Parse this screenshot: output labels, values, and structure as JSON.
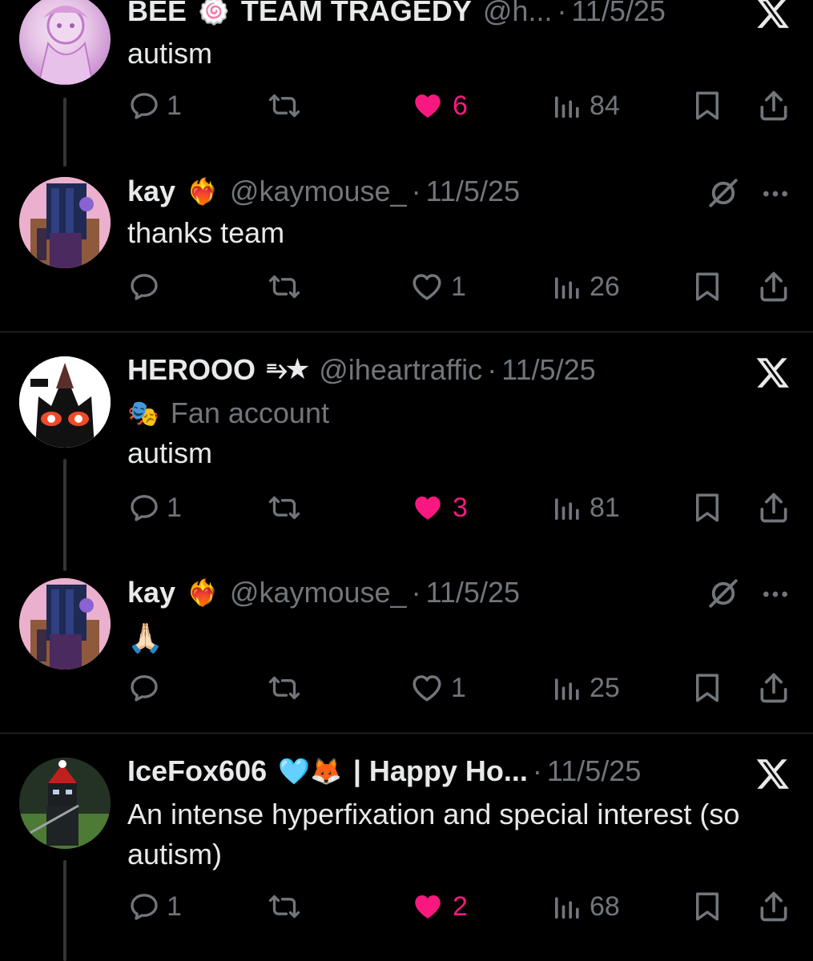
{
  "posts": [
    {
      "name": "BEE",
      "name_badge": "🍥",
      "name_suffix": "TEAM TRAGEDY",
      "handle": "@h...",
      "date": "11/5/25",
      "text": "autism",
      "replies": "1",
      "likes": "6",
      "liked": true,
      "views": "84",
      "corner_icon": "x-logo-icon"
    },
    {
      "name": "kay",
      "name_badge": "❤️‍🔥",
      "handle": "@kaymouse_",
      "date": "11/5/25",
      "text": "thanks team",
      "replies": "",
      "likes": "1",
      "liked": false,
      "views": "26",
      "corner_icon": "grok-icon",
      "more_icon": "more-icon"
    },
    {
      "name": "HEROOO",
      "name_badge": "⥱★",
      "handle": "@iheartraffic",
      "date": "11/5/25",
      "label_icon": "🎭",
      "label": "Fan account",
      "text": "autism",
      "replies": "1",
      "likes": "3",
      "liked": true,
      "views": "81",
      "corner_icon": "x-logo-icon"
    },
    {
      "name": "kay",
      "name_badge": "❤️‍🔥",
      "handle": "@kaymouse_",
      "date": "11/5/25",
      "text": "🙏🏻",
      "replies": "",
      "likes": "1",
      "liked": false,
      "views": "25",
      "corner_icon": "grok-icon",
      "more_icon": "more-icon"
    },
    {
      "name": "IceFox606",
      "name_badge": "🩵🦊",
      "name_suffix": "| Happy Ho...",
      "date": "11/5/25",
      "text": "An intense hyperfixation and special interest (so autism)",
      "replies": "1",
      "likes": "2",
      "liked": true,
      "views": "68",
      "corner_icon": "x-logo-icon"
    }
  ],
  "dot": "·",
  "colors": {
    "background": "#000000",
    "text": "#e7e9ea",
    "muted": "#71767b",
    "like": "#f91880",
    "divider": "#2f3336"
  }
}
